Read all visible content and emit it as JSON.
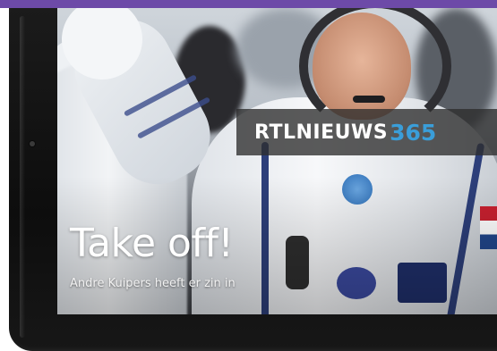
{
  "branding": {
    "band_color": "#6d4aa8",
    "name": "RTLNIEUWS",
    "number": "365",
    "number_color": "#3a9ed9"
  },
  "article": {
    "headline": "Take off!",
    "subline": "Andre Kuipers heeft er zin in"
  },
  "device": {
    "type": "tablet",
    "home_button_icon": "home-button-icon"
  }
}
